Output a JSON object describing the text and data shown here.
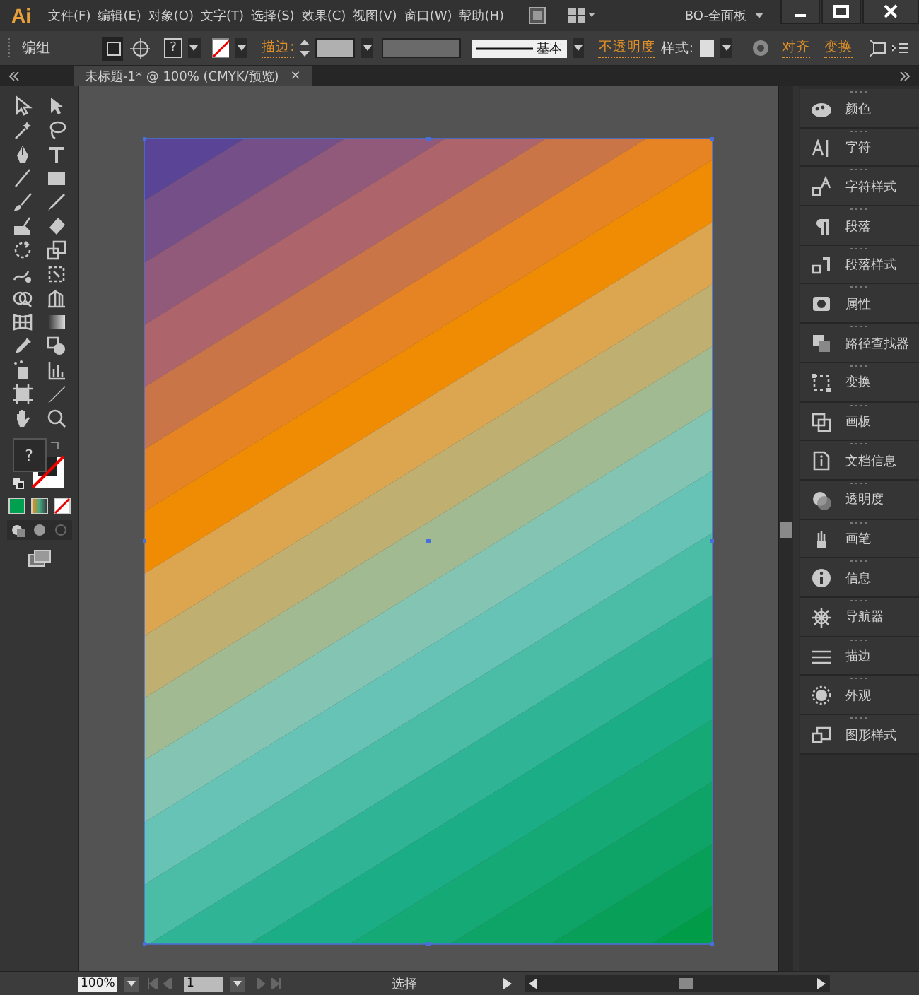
{
  "app_logo": "Ai",
  "menu": [
    "文件(F)",
    "编辑(E)",
    "对象(O)",
    "文字(T)",
    "选择(S)",
    "效果(C)",
    "视图(V)",
    "窗口(W)",
    "帮助(H)"
  ],
  "workspace": "BO-全面板",
  "control_bar": {
    "selection": "编组",
    "fill_swatch": "?",
    "stroke_label": "描边:",
    "stroke_profile": "基本",
    "opacity_link": "不透明度",
    "style_label": "样式:",
    "align_link": "对齐",
    "transform_link": "变换"
  },
  "document_tab": {
    "title": "未标题-1* @ 100% (CMYK/预览)",
    "close": "×"
  },
  "toolbox": {
    "fill_swatch": "?"
  },
  "panels": [
    {
      "label": "颜色"
    },
    {
      "label": "字符"
    },
    {
      "label": "字符样式"
    },
    {
      "label": "段落"
    },
    {
      "label": "段落样式"
    },
    {
      "label": "属性"
    },
    {
      "label": "路径查找器"
    },
    {
      "label": "变换"
    },
    {
      "label": "画板"
    },
    {
      "label": "文档信息"
    },
    {
      "label": "透明度"
    },
    {
      "label": "画笔"
    },
    {
      "label": "信息"
    },
    {
      "label": "导航器"
    },
    {
      "label": "描边"
    },
    {
      "label": "外观"
    },
    {
      "label": "图形样式"
    }
  ],
  "status_bar": {
    "zoom": "100%",
    "artboard": "1",
    "status": "选择"
  }
}
